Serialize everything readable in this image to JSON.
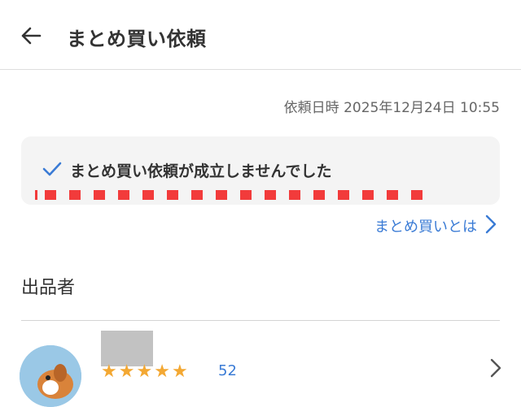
{
  "header": {
    "title": "まとめ買い依頼",
    "back_icon": "arrow-left-icon"
  },
  "request": {
    "date": "依頼日時 2025年12月24日 10:55"
  },
  "status": {
    "icon": "checkmark-icon",
    "message": "まとめ買い依頼が成立しませんでした",
    "accent_color": "#3a7bd5",
    "redline_color": "#f23b3b"
  },
  "link": {
    "label": "まとめ買いとは",
    "icon": "chevron-right-icon"
  },
  "seller": {
    "section_title": "出品者",
    "review_count": "52",
    "rating_icon": "star-icon",
    "chevron_icon": "chevron-right-icon"
  }
}
